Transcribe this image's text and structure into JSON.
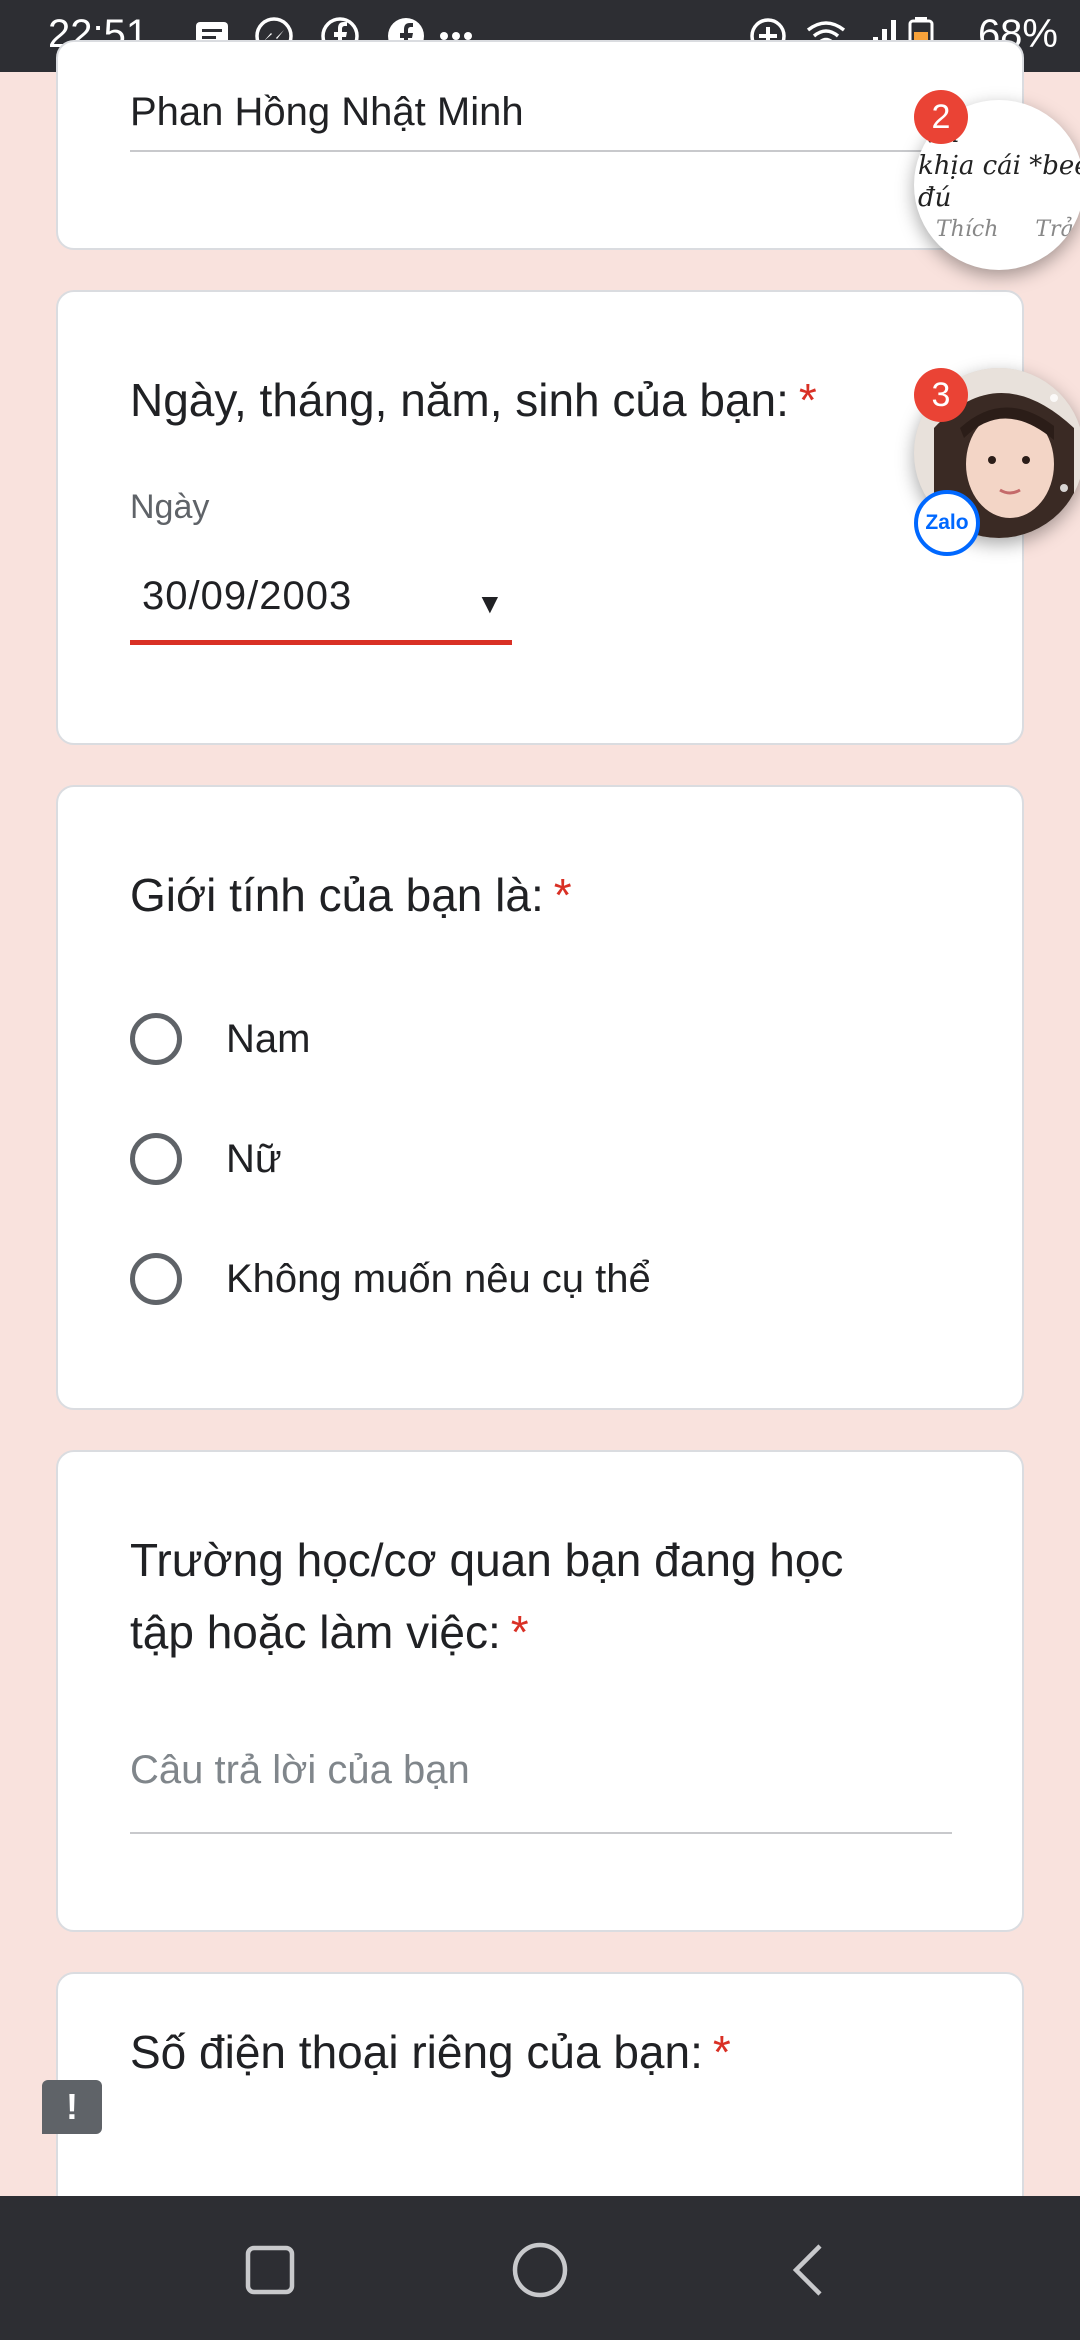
{
  "status_bar": {
    "time": "22:51",
    "battery": "68%",
    "icons": [
      "message-icon",
      "messenger-icon",
      "facebook-icon",
      "facebook-icon",
      "more-dots-icon",
      "data-saver-icon",
      "wifi-icon",
      "signal-icon",
      "battery-icon"
    ]
  },
  "name_card": {
    "value": "Phan Hồng Nhật Minh"
  },
  "dob_card": {
    "question": "Ngày, tháng, năm, sinh của bạn:",
    "required_mark": "*",
    "field_label": "Ngày",
    "value": "30/09/2003",
    "dropdown_glyph": "▼"
  },
  "gender_card": {
    "question": "Giới tính của bạn là:",
    "required_mark": "*",
    "options": [
      "Nam",
      "Nữ",
      "Không muốn nêu cụ thể"
    ]
  },
  "school_card": {
    "question_line1": "Trường học/cơ quan bạn đang học",
    "question_line2": "tập hoặc làm việc:",
    "required_mark": "*",
    "placeholder": "Câu trả lời của bạn"
  },
  "phone_card": {
    "question": "Số điện thoại riêng của bạn:",
    "required_mark": "*"
  },
  "chat_heads": {
    "messenger": {
      "badge": "2",
      "preview_line1": "...n",
      "preview_line2": "khịa cái *beep",
      "preview_line3": "đú",
      "action_like": "Thích",
      "action_reply": "Trả lờ"
    },
    "zalo": {
      "badge": "3",
      "app_label": "Zalo"
    }
  },
  "report_button": {
    "glyph": "!"
  },
  "colors": {
    "page_background": "#f9e2dd",
    "required": "#d93025",
    "status_bar": "#2d2e33"
  }
}
